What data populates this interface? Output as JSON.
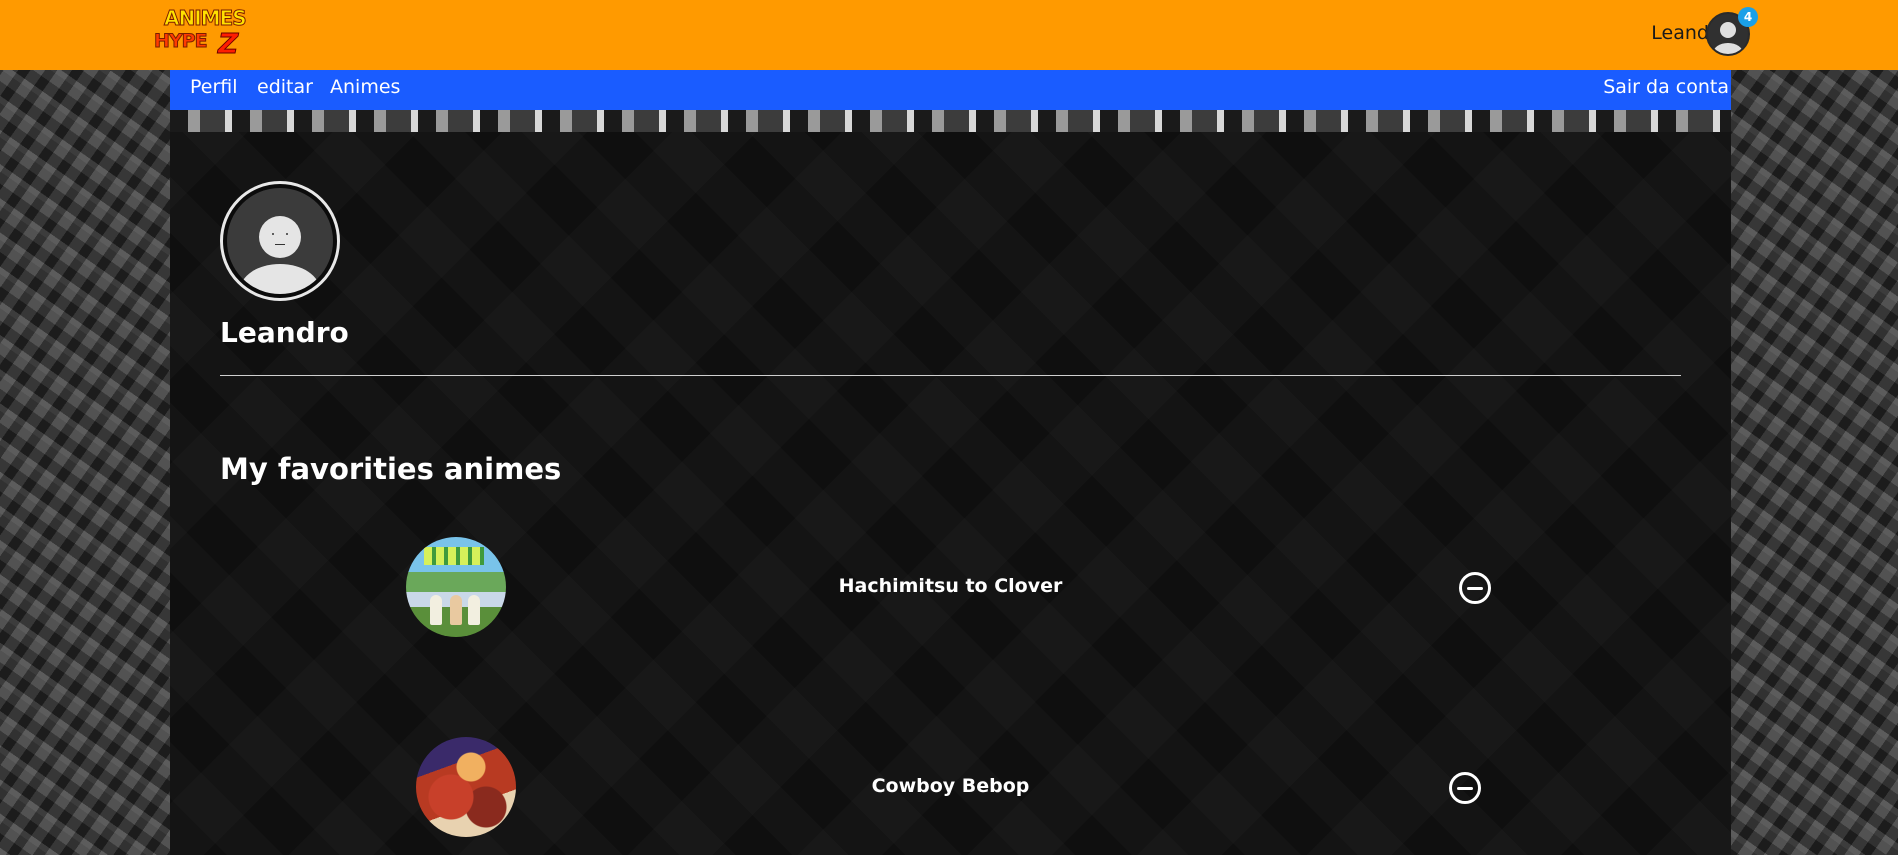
{
  "header": {
    "logo_line1": "ANIMES",
    "logo_line2": "HYPE",
    "logo_z": "Z",
    "username": "Leandro",
    "notification_count": "4"
  },
  "nav": {
    "perfil": "Perfil",
    "editar": "editar",
    "animes": "Animes",
    "logout": "Sair da conta"
  },
  "profile": {
    "name": "Leandro"
  },
  "favorites": {
    "title": "My favorities animes",
    "items": [
      {
        "title": "Hachimitsu to Clover"
      },
      {
        "title": "Cowboy Bebop"
      }
    ]
  },
  "colors": {
    "header_bg": "#ff9a00",
    "nav_bg": "#1a5cff",
    "panel_bg": "#0b0b0b",
    "badge": "#1aa0e8"
  }
}
